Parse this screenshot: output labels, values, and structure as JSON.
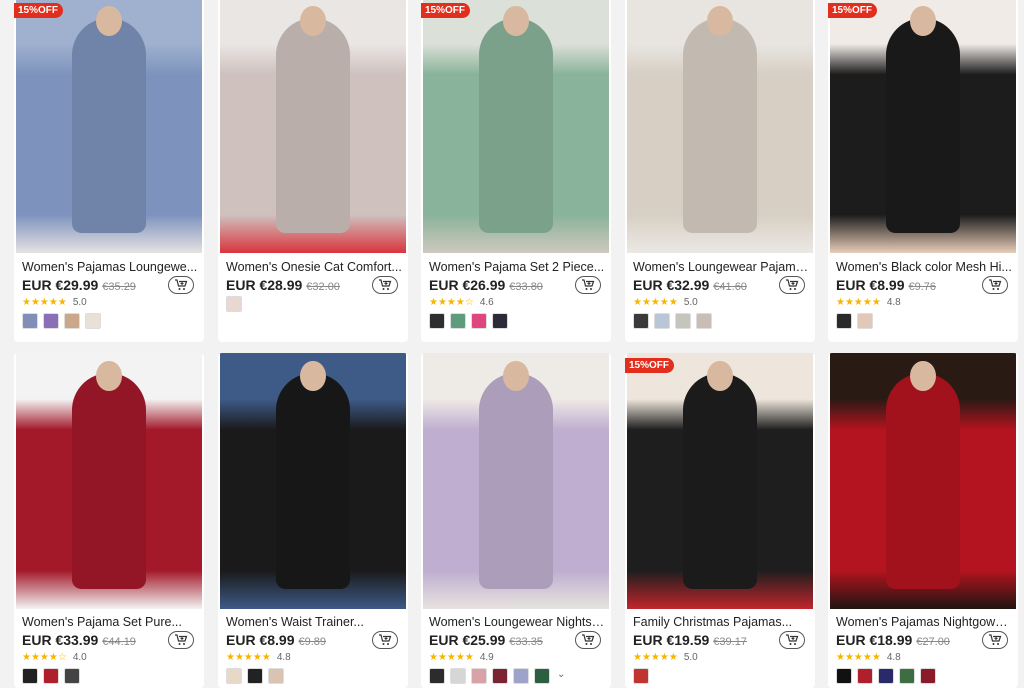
{
  "products": [
    {
      "title": "Women's Pajamas Loungewe...",
      "price": "EUR €29.99",
      "old": "€35.29",
      "rating": "5.0",
      "stars": "★★★★★",
      "badge": "15%OFF",
      "swatch_colors": [
        "#7f8fb8",
        "#8a6fb8",
        "#c9a789",
        "#e9e0d8"
      ],
      "photo": [
        "#9fb1cf",
        "#7d93bd",
        "#e6e2e2"
      ]
    },
    {
      "title": "Women's Onesie Cat Comfort...",
      "price": "EUR €28.99",
      "old": "€32.00",
      "rating": "",
      "stars": "",
      "badge": "",
      "swatch_colors": [
        "#e9d8d2"
      ],
      "photo": [
        "#e9e6e3",
        "#cfc1be",
        "#d9343d"
      ]
    },
    {
      "title": "Women's Pajama Set 2 Piece...",
      "price": "EUR €26.99",
      "old": "€33.80",
      "rating": "4.6",
      "stars": "★★★★☆",
      "badge": "15%OFF",
      "swatch_colors": [
        "#2e2e2e",
        "#5f9c7d",
        "#e0467e",
        "#2b2b3a"
      ],
      "photo": [
        "#dbe0d8",
        "#89b39a",
        "#cfc8be"
      ]
    },
    {
      "title": "Women's Loungewear Pajama...",
      "price": "EUR €32.99",
      "old": "€41.60",
      "rating": "5.0",
      "stars": "★★★★★",
      "badge": "",
      "swatch_colors": [
        "#3a3a3a",
        "#b8c6d6",
        "#c5c5bd",
        "#c9bdb5"
      ],
      "photo": [
        "#e8e5e1",
        "#d7cfc4",
        "#ebe8e4"
      ]
    },
    {
      "title": "Women's Black color Mesh Hi...",
      "price": "EUR €8.99",
      "old": "€9.76",
      "rating": "4.8",
      "stars": "★★★★★",
      "badge": "15%OFF",
      "swatch_colors": [
        "#2a2a2a",
        "#e2c8b8"
      ],
      "photo": [
        "#f0ebe7",
        "#1c1c1c",
        "#e8cdb9"
      ]
    },
    {
      "title": "Women's Pajama Set Pure...",
      "price": "EUR €33.99",
      "old": "€44.19",
      "rating": "4.0",
      "stars": "★★★★☆",
      "badge": "",
      "swatch_colors": [
        "#222",
        "#b01f2c",
        "#444"
      ],
      "photo": [
        "#f3f3f3",
        "#a3192a",
        "#f3f3f3"
      ]
    },
    {
      "title": "Women's Waist Trainer...",
      "price": "EUR €8.99",
      "old": "€9.89",
      "rating": "4.8",
      "stars": "★★★★★",
      "badge": "",
      "swatch_colors": [
        "#e7d8c8",
        "#222",
        "#d9c4b2"
      ],
      "photo": [
        "#3e5a87",
        "#1a1a1a",
        "#3e5a87"
      ]
    },
    {
      "title": "Women's Loungewear Nightsh...",
      "price": "EUR €25.99",
      "old": "€33.35",
      "rating": "4.9",
      "stars": "★★★★★",
      "badge": "",
      "swatch_colors": [
        "#2c2c2c",
        "#d6d6d6",
        "#d9a2a7",
        "#7a2531",
        "#9ea3c9",
        "#2b5f3f"
      ],
      "photo": [
        "#eeeae6",
        "#bfaed0",
        "#e7e3df"
      ]
    },
    {
      "title": "Family Christmas Pajamas...",
      "price": "EUR €19.59",
      "old": "€39.17",
      "rating": "5.0",
      "stars": "★★★★★",
      "badge": "15%OFF",
      "swatch_colors": [
        "#c0352f"
      ],
      "photo": [
        "#eee6dc",
        "#1e1e1e",
        "#c0262c"
      ]
    },
    {
      "title": "Women's Pajamas Nightgown...",
      "price": "EUR €18.99",
      "old": "€27.00",
      "rating": "4.8",
      "stars": "★★★★★",
      "badge": "",
      "swatch_colors": [
        "#111",
        "#b01f2c",
        "#2a2a6a",
        "#3d6e42",
        "#8b1a2a"
      ],
      "photo": [
        "#2a1a14",
        "#b3141f",
        "#1f1410"
      ]
    }
  ],
  "more_colors_indicator": "⌄"
}
